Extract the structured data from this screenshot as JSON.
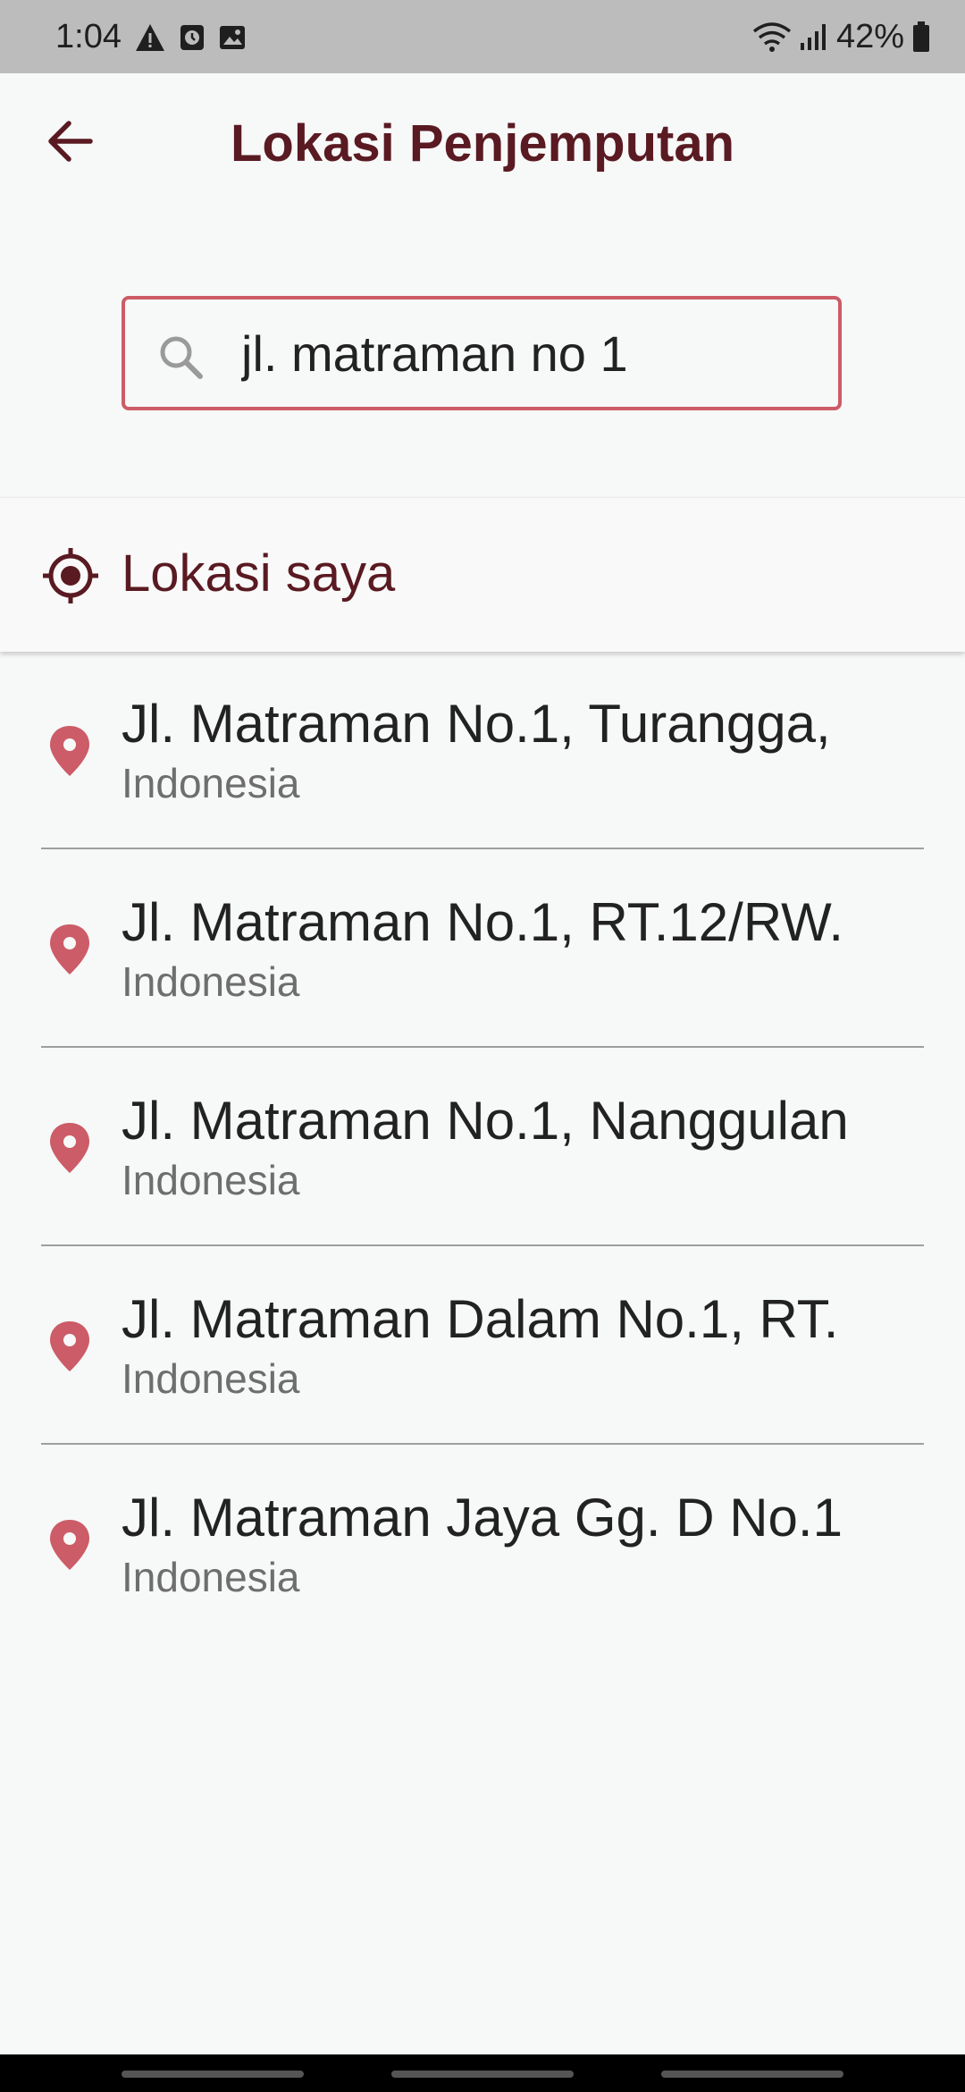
{
  "status_bar": {
    "time": "1:04",
    "battery": "42%"
  },
  "header": {
    "title": "Lokasi Penjemputan"
  },
  "search": {
    "value": "jl. matraman no 1",
    "placeholder": ""
  },
  "my_location": {
    "label": "Lokasi saya"
  },
  "results": [
    {
      "title": "Jl. Matraman No.1, Turangga,",
      "subtitle": "Indonesia"
    },
    {
      "title": "Jl. Matraman No.1, RT.12/RW.",
      "subtitle": "Indonesia"
    },
    {
      "title": "Jl. Matraman No.1, Nanggulan",
      "subtitle": "Indonesia"
    },
    {
      "title": "Jl. Matraman Dalam No.1, RT.",
      "subtitle": "Indonesia"
    },
    {
      "title": "Jl. Matraman Jaya Gg. D No.1",
      "subtitle": "Indonesia"
    }
  ],
  "colors": {
    "accent": "#5a1a22",
    "pin": "#cc5c67",
    "search_border": "#cc5c67"
  },
  "icons": {
    "back": "arrow-left-icon",
    "search": "search-icon",
    "my_location": "my-location-icon",
    "pin": "location-pin-icon"
  }
}
